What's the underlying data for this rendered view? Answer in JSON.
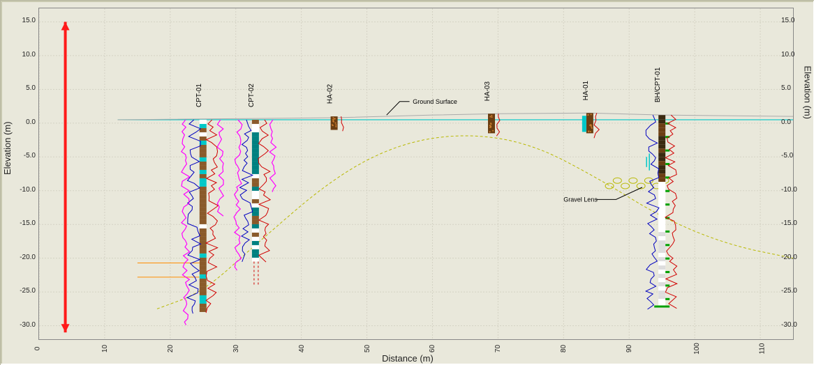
{
  "chart_data": {
    "type": "section",
    "xlabel": "Distance (m)",
    "ylabel_left": "Elevation (m)",
    "ylabel_right": "Elevation (m)",
    "x_ticks": [
      0,
      10,
      20,
      30,
      40,
      50,
      60,
      70,
      80,
      90,
      100,
      110
    ],
    "y_ticks": [
      15.0,
      10.0,
      5.0,
      0.0,
      -5.0,
      -10.0,
      -15.0,
      -20.0,
      -25.0,
      -30.0
    ],
    "xlim": [
      0,
      115
    ],
    "ylim": [
      -32,
      17
    ],
    "water_level_elev": 0.5,
    "ground_surface": [
      [
        12,
        0.5
      ],
      [
        45,
        0.8
      ],
      [
        60,
        1.2
      ],
      [
        70,
        1.4
      ],
      [
        84,
        1.5
      ],
      [
        95,
        1.2
      ],
      [
        115,
        1.0
      ]
    ],
    "dune_curve": [
      [
        18,
        -27.5
      ],
      [
        25,
        -25
      ],
      [
        33,
        -18
      ],
      [
        45,
        -8
      ],
      [
        55,
        -3
      ],
      [
        65,
        -1.5
      ],
      [
        75,
        -3
      ],
      [
        85,
        -8
      ],
      [
        95,
        -14
      ],
      [
        105,
        -18
      ],
      [
        115,
        -20
      ]
    ],
    "orange_markers_elev": [
      -20.7,
      -22.8
    ],
    "annotations": {
      "ground_surface": "Ground Surface",
      "gravel_lens": "Gravel Lens"
    },
    "bores": [
      {
        "id": "CPT-01",
        "x": 25,
        "top": 0.5,
        "base": -28,
        "pattern": "brown",
        "cpt_traces": true,
        "magenta_trace": true
      },
      {
        "id": "CPT-02",
        "x": 33,
        "top": 0.5,
        "base": -20.5,
        "pattern": "teal",
        "cpt_traces": true,
        "magenta_trace": true
      },
      {
        "id": "HA-02",
        "x": 45,
        "top": 1,
        "base": -1,
        "pattern": "gravel"
      },
      {
        "id": "HA-03",
        "x": 69,
        "top": 1.4,
        "base": -1.5,
        "pattern": "gravel"
      },
      {
        "id": "HA-01",
        "x": 84,
        "top": 1.5,
        "base": -1.5,
        "pattern": "gravel"
      },
      {
        "id": "BH/CPT-01",
        "x": 95,
        "top": 1.2,
        "base": -27,
        "pattern": "mixed",
        "cpt_traces": true
      }
    ],
    "gravel_lens_elev": -9
  }
}
